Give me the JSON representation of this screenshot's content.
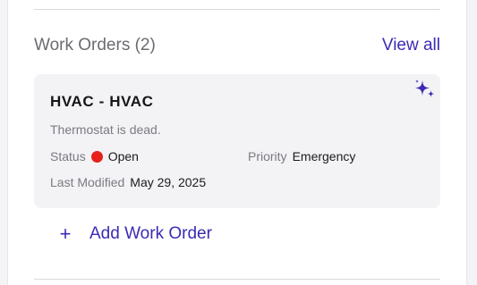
{
  "work_orders": {
    "title": "Work Orders (2)",
    "view_all_label": "View all",
    "add_label": "Add Work Order",
    "items": [
      {
        "title": "HVAC - HVAC",
        "description": "Thermostat is dead.",
        "status_label": "Status",
        "status_value": "Open",
        "status_color": "#e8201c",
        "priority_label": "Priority",
        "priority_value": "Emergency",
        "modified_label": "Last Modified",
        "modified_value": "May 29, 2025"
      }
    ]
  },
  "icons": {
    "sparkle": "sparkle-icon",
    "plus": "plus-icon"
  },
  "colors": {
    "accent": "#3a2bb5",
    "card_bg": "#f3f3f6",
    "status_open": "#e8201c"
  }
}
